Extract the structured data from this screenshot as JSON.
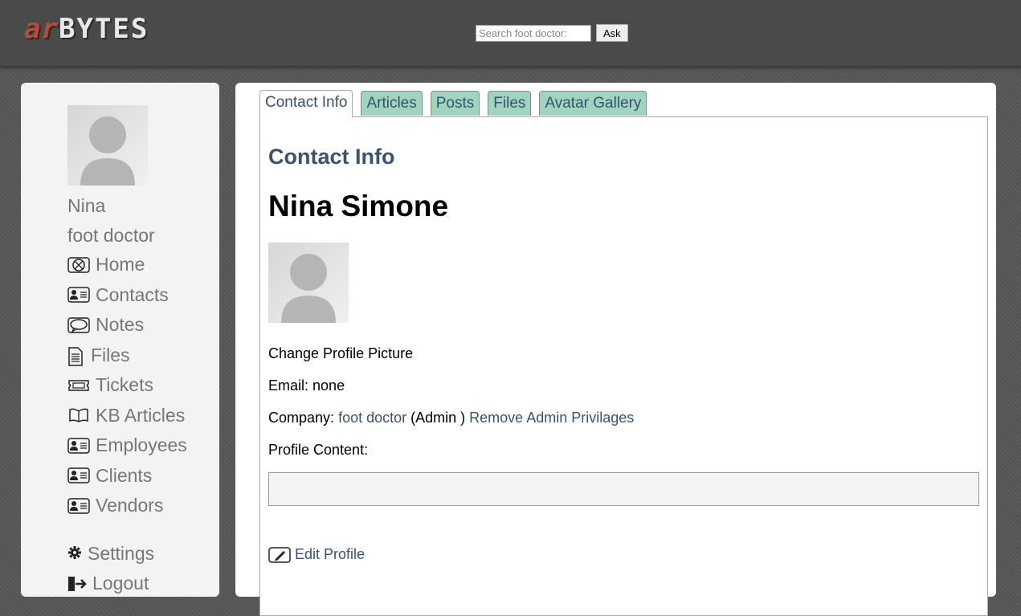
{
  "header": {
    "logo_part1": "ar",
    "logo_part2": "BYTES",
    "search_placeholder": "Search foot doctor:",
    "ask_label": "Ask"
  },
  "sidebar": {
    "user_name": "Nina",
    "company": "foot doctor",
    "nav": [
      {
        "label": "Home",
        "icon": "home-icon"
      },
      {
        "label": "Contacts",
        "icon": "contact-card-icon"
      },
      {
        "label": "Notes",
        "icon": "speech-bubble-icon"
      },
      {
        "label": "Files",
        "icon": "document-icon"
      },
      {
        "label": "Tickets",
        "icon": "ticket-icon"
      },
      {
        "label": "KB Articles",
        "icon": "book-icon"
      },
      {
        "label": "Employees",
        "icon": "contact-card-icon"
      },
      {
        "label": "Clients",
        "icon": "contact-card-icon"
      },
      {
        "label": "Vendors",
        "icon": "contact-card-icon"
      }
    ],
    "settings_label": "Settings",
    "logout_label": "Logout"
  },
  "tabs": [
    "Contact Info",
    "Articles",
    "Posts",
    "Files",
    "Avatar Gallery"
  ],
  "active_tab": "Contact Info",
  "panel": {
    "heading": "Contact Info",
    "full_name": "Nina Simone",
    "change_picture_label": "Change Profile Picture",
    "email_label": "Email:",
    "email_value": "none",
    "company_label": "Company:",
    "company_link": "foot doctor",
    "role_text": "(Admin )",
    "remove_admin_label": "Remove Admin Privilages",
    "profile_content_label": "Profile Content:",
    "profile_content_value": "",
    "edit_profile_label": "Edit Profile"
  },
  "colors": {
    "accent": "#3a5270",
    "tab_bg": "#9fd4bf",
    "logo_red": "#b84a3a"
  }
}
